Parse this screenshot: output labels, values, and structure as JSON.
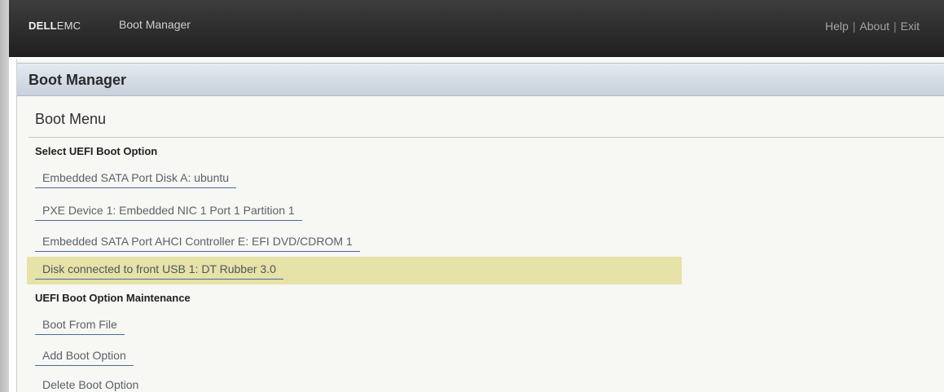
{
  "header": {
    "logo_bold": "DELL",
    "logo_light": "EMC",
    "app_title": "Boot Manager",
    "links": [
      "Help",
      "About",
      "Exit"
    ],
    "separator": "|"
  },
  "panel": {
    "title": "Boot Manager",
    "menu_title": "Boot Menu"
  },
  "sections": [
    {
      "label": "Select UEFI Boot Option",
      "options": [
        "Embedded SATA Port Disk A: ubuntu",
        "PXE Device 1: Embedded NIC 1 Port 1 Partition 1",
        "Embedded SATA Port AHCI Controller E: EFI DVD/CDROM 1",
        "Disk connected to front USB 1: DT Rubber 3.0"
      ],
      "selected_index": 3
    },
    {
      "label": "UEFI Boot Option Maintenance",
      "options": [
        "Boot From File",
        "Add Boot Option",
        "Delete Boot Option"
      ]
    }
  ],
  "colors": {
    "header_bg": "#2b2b2b",
    "panel_header_bg": "#d3dbe4",
    "highlight_bg": "#e6e2a8",
    "link_underline": "#4a6a9a"
  }
}
